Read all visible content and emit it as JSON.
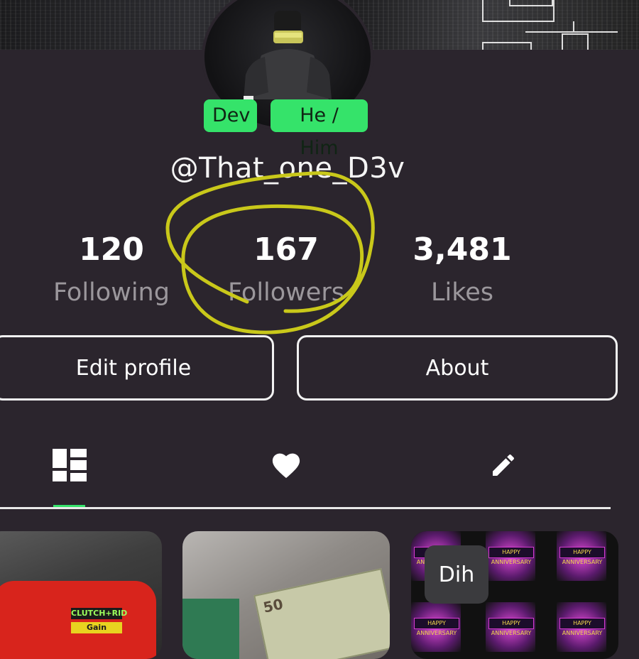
{
  "profile": {
    "badges": [
      "Dev",
      "He / Him"
    ],
    "username": "@That_one_D3v"
  },
  "stats": [
    {
      "value": "120",
      "label": "Following"
    },
    {
      "value": "167",
      "label": "Followers"
    },
    {
      "value": "3,481",
      "label": "Likes"
    }
  ],
  "actions": {
    "edit_label": "Edit profile",
    "about_label": "About"
  },
  "tabs": [
    {
      "icon": "grid-icon",
      "active": true
    },
    {
      "icon": "heart-icon",
      "active": false
    },
    {
      "icon": "pencil-icon",
      "active": false
    }
  ],
  "posts": [
    {
      "caption": ""
    },
    {
      "caption": ""
    },
    {
      "caption": "Dih"
    }
  ],
  "annotation": {
    "color": "#c9c81a"
  },
  "colors": {
    "accent": "#35e36a",
    "background": "#2b252d"
  }
}
